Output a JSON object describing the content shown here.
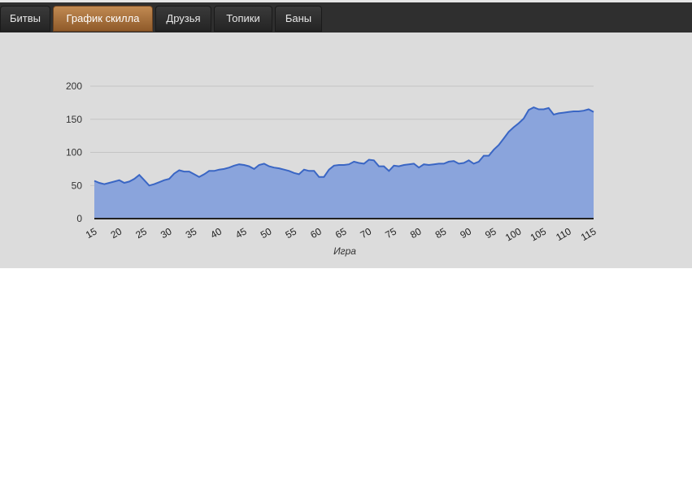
{
  "tabs": [
    {
      "label": "Битвы",
      "active": false
    },
    {
      "label": "График скилла",
      "active": true
    },
    {
      "label": "Друзья",
      "active": false
    },
    {
      "label": "Топики",
      "active": false
    },
    {
      "label": "Баны",
      "active": false
    }
  ],
  "colors": {
    "accent_tab": "#a7703d",
    "series_line": "#3a66c4",
    "series_fill": "#8aa4dc"
  },
  "chart_data": {
    "type": "area",
    "title": "",
    "xlabel": "Игра",
    "ylabel": "",
    "xlim": [
      15,
      115
    ],
    "ylim": [
      0,
      200
    ],
    "x_ticks": [
      15,
      20,
      25,
      30,
      35,
      40,
      45,
      50,
      55,
      60,
      65,
      70,
      75,
      80,
      85,
      90,
      95,
      100,
      105,
      110,
      115
    ],
    "y_ticks": [
      0,
      50,
      100,
      150,
      200
    ],
    "grid": "horizontal",
    "legend": "none",
    "x": [
      15,
      16,
      17,
      18,
      19,
      20,
      21,
      22,
      23,
      24,
      25,
      26,
      27,
      28,
      29,
      30,
      31,
      32,
      33,
      34,
      35,
      36,
      37,
      38,
      39,
      40,
      41,
      42,
      43,
      44,
      45,
      46,
      47,
      48,
      49,
      50,
      51,
      52,
      53,
      54,
      55,
      56,
      57,
      58,
      59,
      60,
      61,
      62,
      63,
      64,
      65,
      66,
      67,
      68,
      69,
      70,
      71,
      72,
      73,
      74,
      75,
      76,
      77,
      78,
      79,
      80,
      81,
      82,
      83,
      84,
      85,
      86,
      87,
      88,
      89,
      90,
      91,
      92,
      93,
      94,
      95,
      96,
      97,
      98,
      99,
      100,
      101,
      102,
      103,
      104,
      105,
      106,
      107,
      108,
      109,
      110,
      111,
      112,
      113,
      114,
      115
    ],
    "values": [
      57,
      54,
      52,
      54,
      56,
      58,
      54,
      56,
      60,
      66,
      58,
      50,
      52,
      55,
      58,
      60,
      68,
      73,
      71,
      71,
      67,
      63,
      67,
      72,
      72,
      74,
      75,
      77,
      80,
      82,
      81,
      79,
      75,
      81,
      83,
      79,
      77,
      76,
      74,
      72,
      69,
      67,
      74,
      72,
      72,
      63,
      63,
      74,
      80,
      81,
      81,
      82,
      86,
      84,
      83,
      89,
      88,
      79,
      79,
      72,
      80,
      79,
      81,
      82,
      83,
      77,
      82,
      81,
      82,
      83,
      83,
      86,
      87,
      83,
      84,
      88,
      83,
      86,
      95,
      95,
      104,
      111,
      121,
      131,
      138,
      144,
      151,
      164,
      168,
      165,
      165,
      167,
      157,
      159,
      160,
      161,
      162,
      162,
      163,
      165,
      161
    ]
  }
}
